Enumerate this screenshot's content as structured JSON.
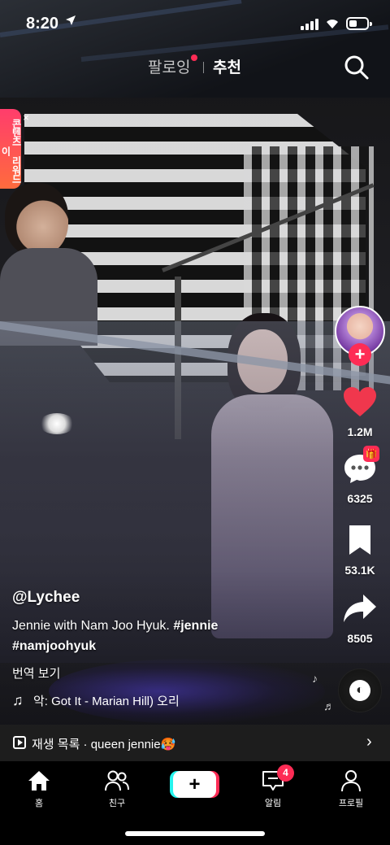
{
  "status_bar": {
    "time": "8:20",
    "location_icon": "location-arrow-icon",
    "battery_level": 0.45
  },
  "top_nav": {
    "following_label": "팔로잉",
    "for_you_label": "추천",
    "active_tab": "추천"
  },
  "reward_badge": {
    "label": "콘텐츠 리워드 이",
    "close_label": "×"
  },
  "actions": {
    "like_count": "1.2M",
    "comment_count": "6325",
    "save_count": "53.1K",
    "share_count": "8505",
    "follow_label": "+"
  },
  "caption": {
    "username": "@Lychee",
    "text_plain": "Jennie with Nam Joo Hyuk. ",
    "hashtag_1": "#jennie",
    "hashtag_2": "#namjoohyuk",
    "translate_label": "번역 보기"
  },
  "music": {
    "track": "악: Got It - Marian Hill)   오리"
  },
  "playlist": {
    "label": "재생 목록 ·  queen jennie🥵"
  },
  "bottom_nav": {
    "home_label": "홈",
    "friends_label": "친구",
    "create_label": "+",
    "inbox_label": "알림",
    "inbox_badge": "4",
    "profile_label": "프로필"
  },
  "colors": {
    "accent": "#fe2c55",
    "create_cyan": "#25f4ee",
    "like_red": "#f0374d"
  }
}
